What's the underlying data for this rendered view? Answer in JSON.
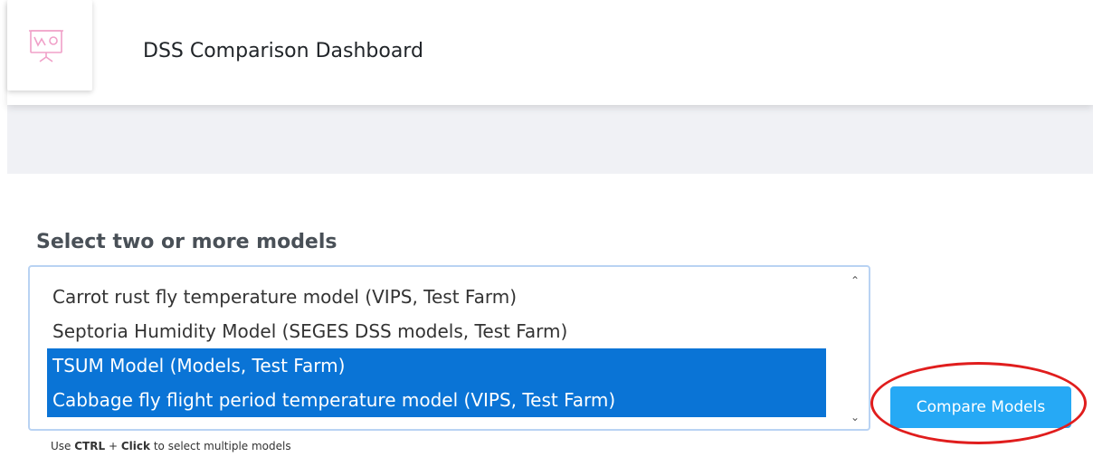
{
  "header": {
    "title": "DSS Comparison Dashboard",
    "logo_icon": "presentation-chart-icon"
  },
  "selector": {
    "heading": "Select two or more models",
    "options": [
      {
        "label": "Carrot rust fly temperature model (VIPS, Test Farm)",
        "selected": false
      },
      {
        "label": "Septoria Humidity Model (SEGES DSS models, Test Farm)",
        "selected": false
      },
      {
        "label": "TSUM Model (Models, Test Farm)",
        "selected": true
      },
      {
        "label": "Cabbage fly flight period temperature model (VIPS, Test Farm)",
        "selected": true
      }
    ]
  },
  "compare_button": {
    "label": "Compare Models"
  },
  "hint": {
    "prefix": "Use",
    "key1": "CTRL",
    "plus": "+",
    "key2": "Click",
    "suffix": "to select multiple models"
  },
  "colors": {
    "selected_option": "#0a74d6",
    "button": "#26a9f5",
    "annotation_ring": "#e01d1d",
    "band": "#f0f1f5"
  }
}
